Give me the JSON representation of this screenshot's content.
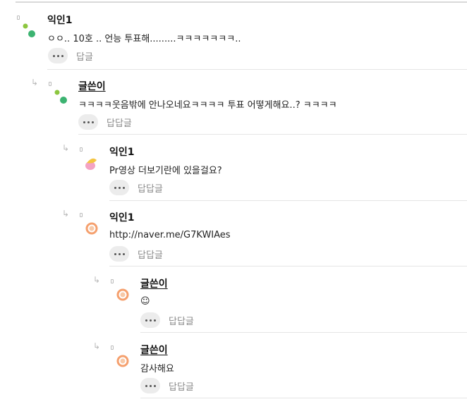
{
  "comments": [
    {
      "author": "익인1",
      "text": "ㅇㅇ.. 10호 .. 언능 투표해.........ㅋㅋㅋㅋㅋㅋㅋ..",
      "reply_label": "답글",
      "avatar": "green-dots"
    },
    {
      "author": "글쓴이",
      "text": "ㅋㅋㅋㅋ웃음밖에 안나오네요ㅋㅋㅋㅋ 투표 어떻게해요..? ㅋㅋㅋㅋ",
      "reply_label": "답답글",
      "avatar": "green-dots"
    },
    {
      "author": "익인1",
      "text": "Pr영상 더보기란에 있을걸요?",
      "reply_label": "답답글",
      "avatar": "yellow-pink-blob"
    },
    {
      "author": "익인1",
      "text": "http://naver.me/G7KWIAes",
      "reply_label": "답답글",
      "avatar": "orange-ring"
    },
    {
      "author": "글쓴이",
      "text": "☺",
      "reply_label": "답답글",
      "avatar": "orange-ring"
    },
    {
      "author": "글쓴이",
      "text": "감사해요",
      "reply_label": "답답글",
      "avatar": "orange-ring"
    }
  ],
  "colors": {
    "green_light": "#8cc63f",
    "green_dark": "#3cb371",
    "orange": "#f5a06e",
    "yellow": "#f4c542",
    "pink": "#f4a3c4"
  }
}
